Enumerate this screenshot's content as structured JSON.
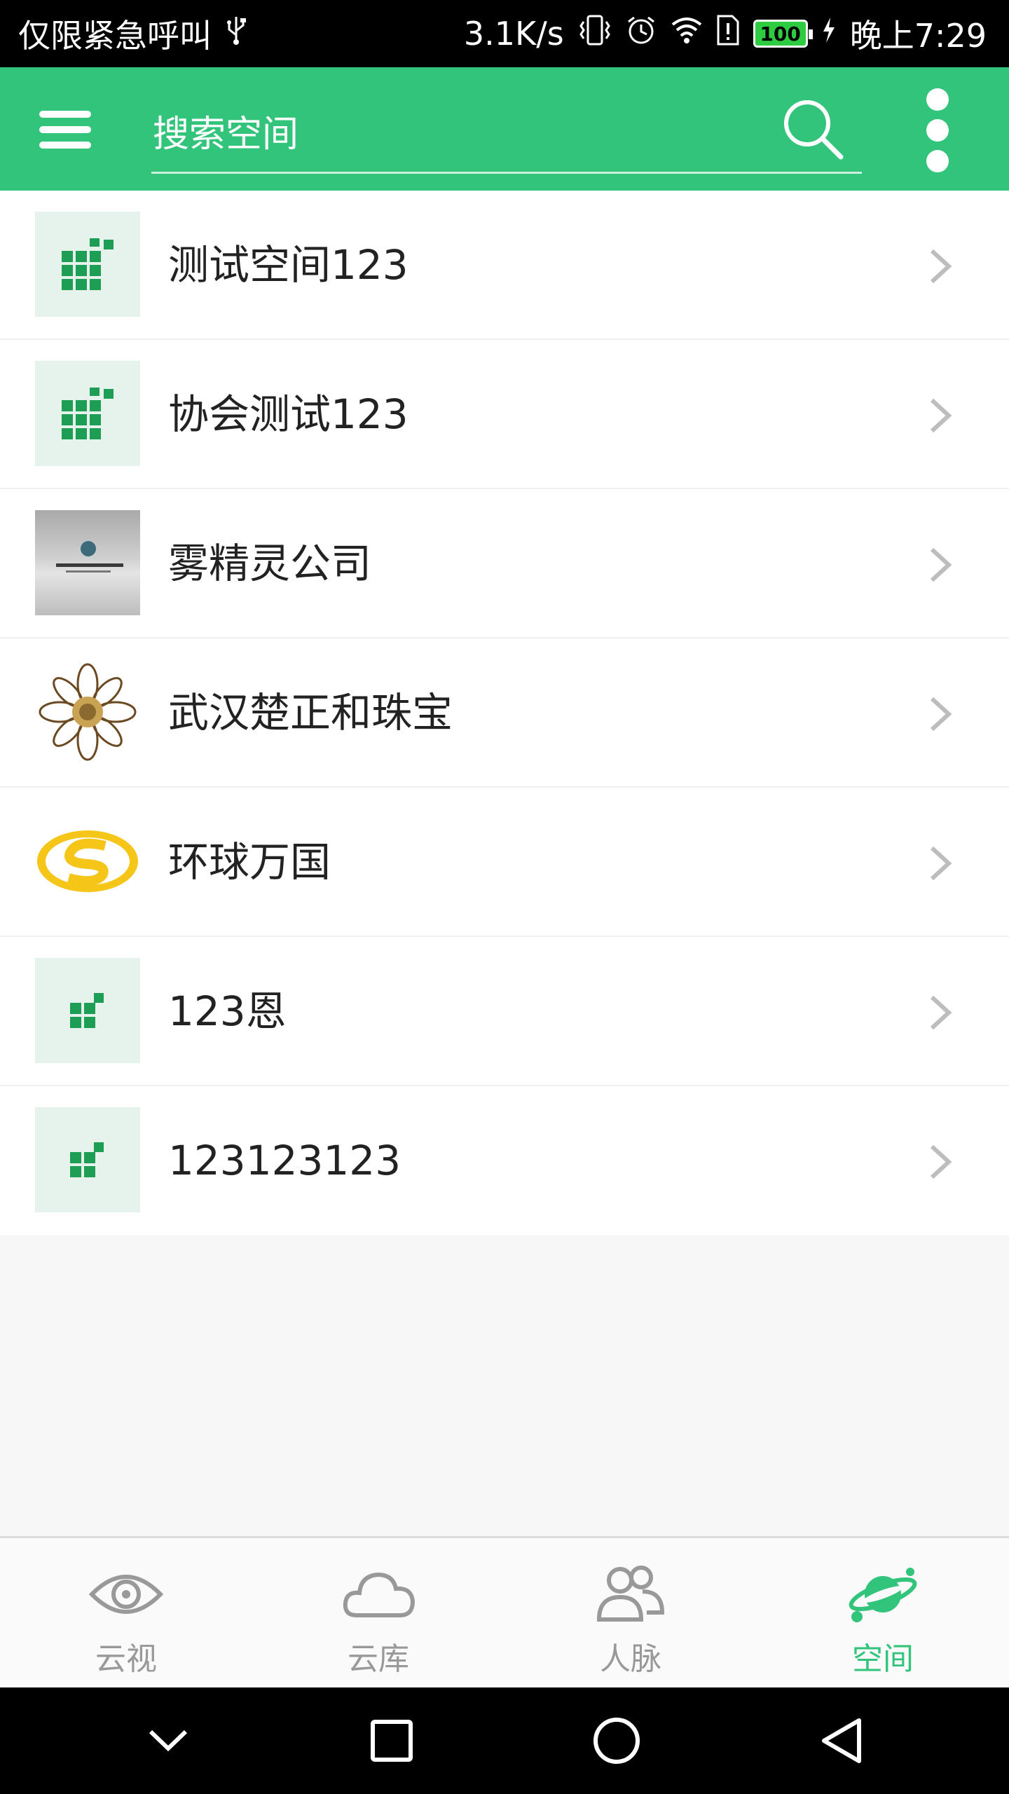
{
  "status_bar": {
    "carrier": "仅限紧急呼叫",
    "usb_icon": "usb-icon",
    "network_speed": "3.1K/s",
    "battery": "100",
    "time": "晚上7:29"
  },
  "app_bar": {
    "search_placeholder": "搜索空间",
    "menu_icon": "hamburger-menu-icon",
    "search_icon": "search-icon",
    "more_icon": "more-vertical-icon",
    "color": "#33c47b"
  },
  "spaces": [
    {
      "name": "测试空间123",
      "icon": "grid-app-icon"
    },
    {
      "name": "协会测试123",
      "icon": "grid-app-icon"
    },
    {
      "name": "雾精灵公司",
      "icon": "company-photo"
    },
    {
      "name": "武汉楚正和珠宝",
      "icon": "mandala-logo"
    },
    {
      "name": "环球万国",
      "icon": "yellow-s-logo"
    },
    {
      "name": "123恩",
      "icon": "small-grid-icon"
    },
    {
      "name": "123123123",
      "icon": "small-grid-icon"
    }
  ],
  "bottom_nav": {
    "tabs": [
      {
        "label": "云视",
        "icon": "eye-icon"
      },
      {
        "label": "云库",
        "icon": "cloud-icon"
      },
      {
        "label": "人脉",
        "icon": "people-icon"
      },
      {
        "label": "空间",
        "icon": "planet-icon",
        "active": true
      }
    ]
  },
  "system_nav": [
    "collapse-icon",
    "recents-square-icon",
    "home-circle-icon",
    "back-triangle-icon"
  ]
}
